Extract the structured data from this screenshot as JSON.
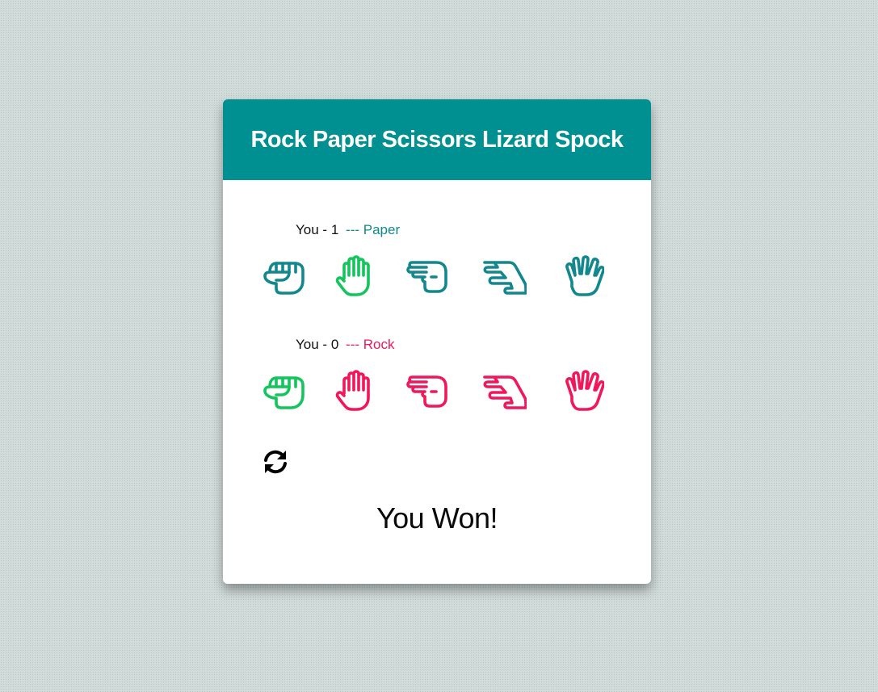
{
  "title": "Rock Paper Scissors Lizard Spock",
  "colors": {
    "header": "#009091",
    "player_hand": "#12878d",
    "computer_hand": "#f0175a",
    "selected": "#14c45c"
  },
  "player": {
    "name": "You",
    "score_sep": "-",
    "score": "1",
    "dashes": "---",
    "choice": "Paper",
    "hands": [
      {
        "name": "rock-icon",
        "selected": false
      },
      {
        "name": "paper-icon",
        "selected": true
      },
      {
        "name": "scissors-icon",
        "selected": false
      },
      {
        "name": "lizard-icon",
        "selected": false
      },
      {
        "name": "spock-icon",
        "selected": false
      }
    ]
  },
  "computer": {
    "name": "You",
    "score_sep": "-",
    "score": "0",
    "dashes": "---",
    "choice": "Rock",
    "hands": [
      {
        "name": "rock-icon",
        "selected": true
      },
      {
        "name": "paper-icon",
        "selected": false
      },
      {
        "name": "scissors-icon",
        "selected": false
      },
      {
        "name": "lizard-icon",
        "selected": false
      },
      {
        "name": "spock-icon",
        "selected": false
      }
    ]
  },
  "reset_icon": "refresh-icon",
  "result": "You Won!"
}
